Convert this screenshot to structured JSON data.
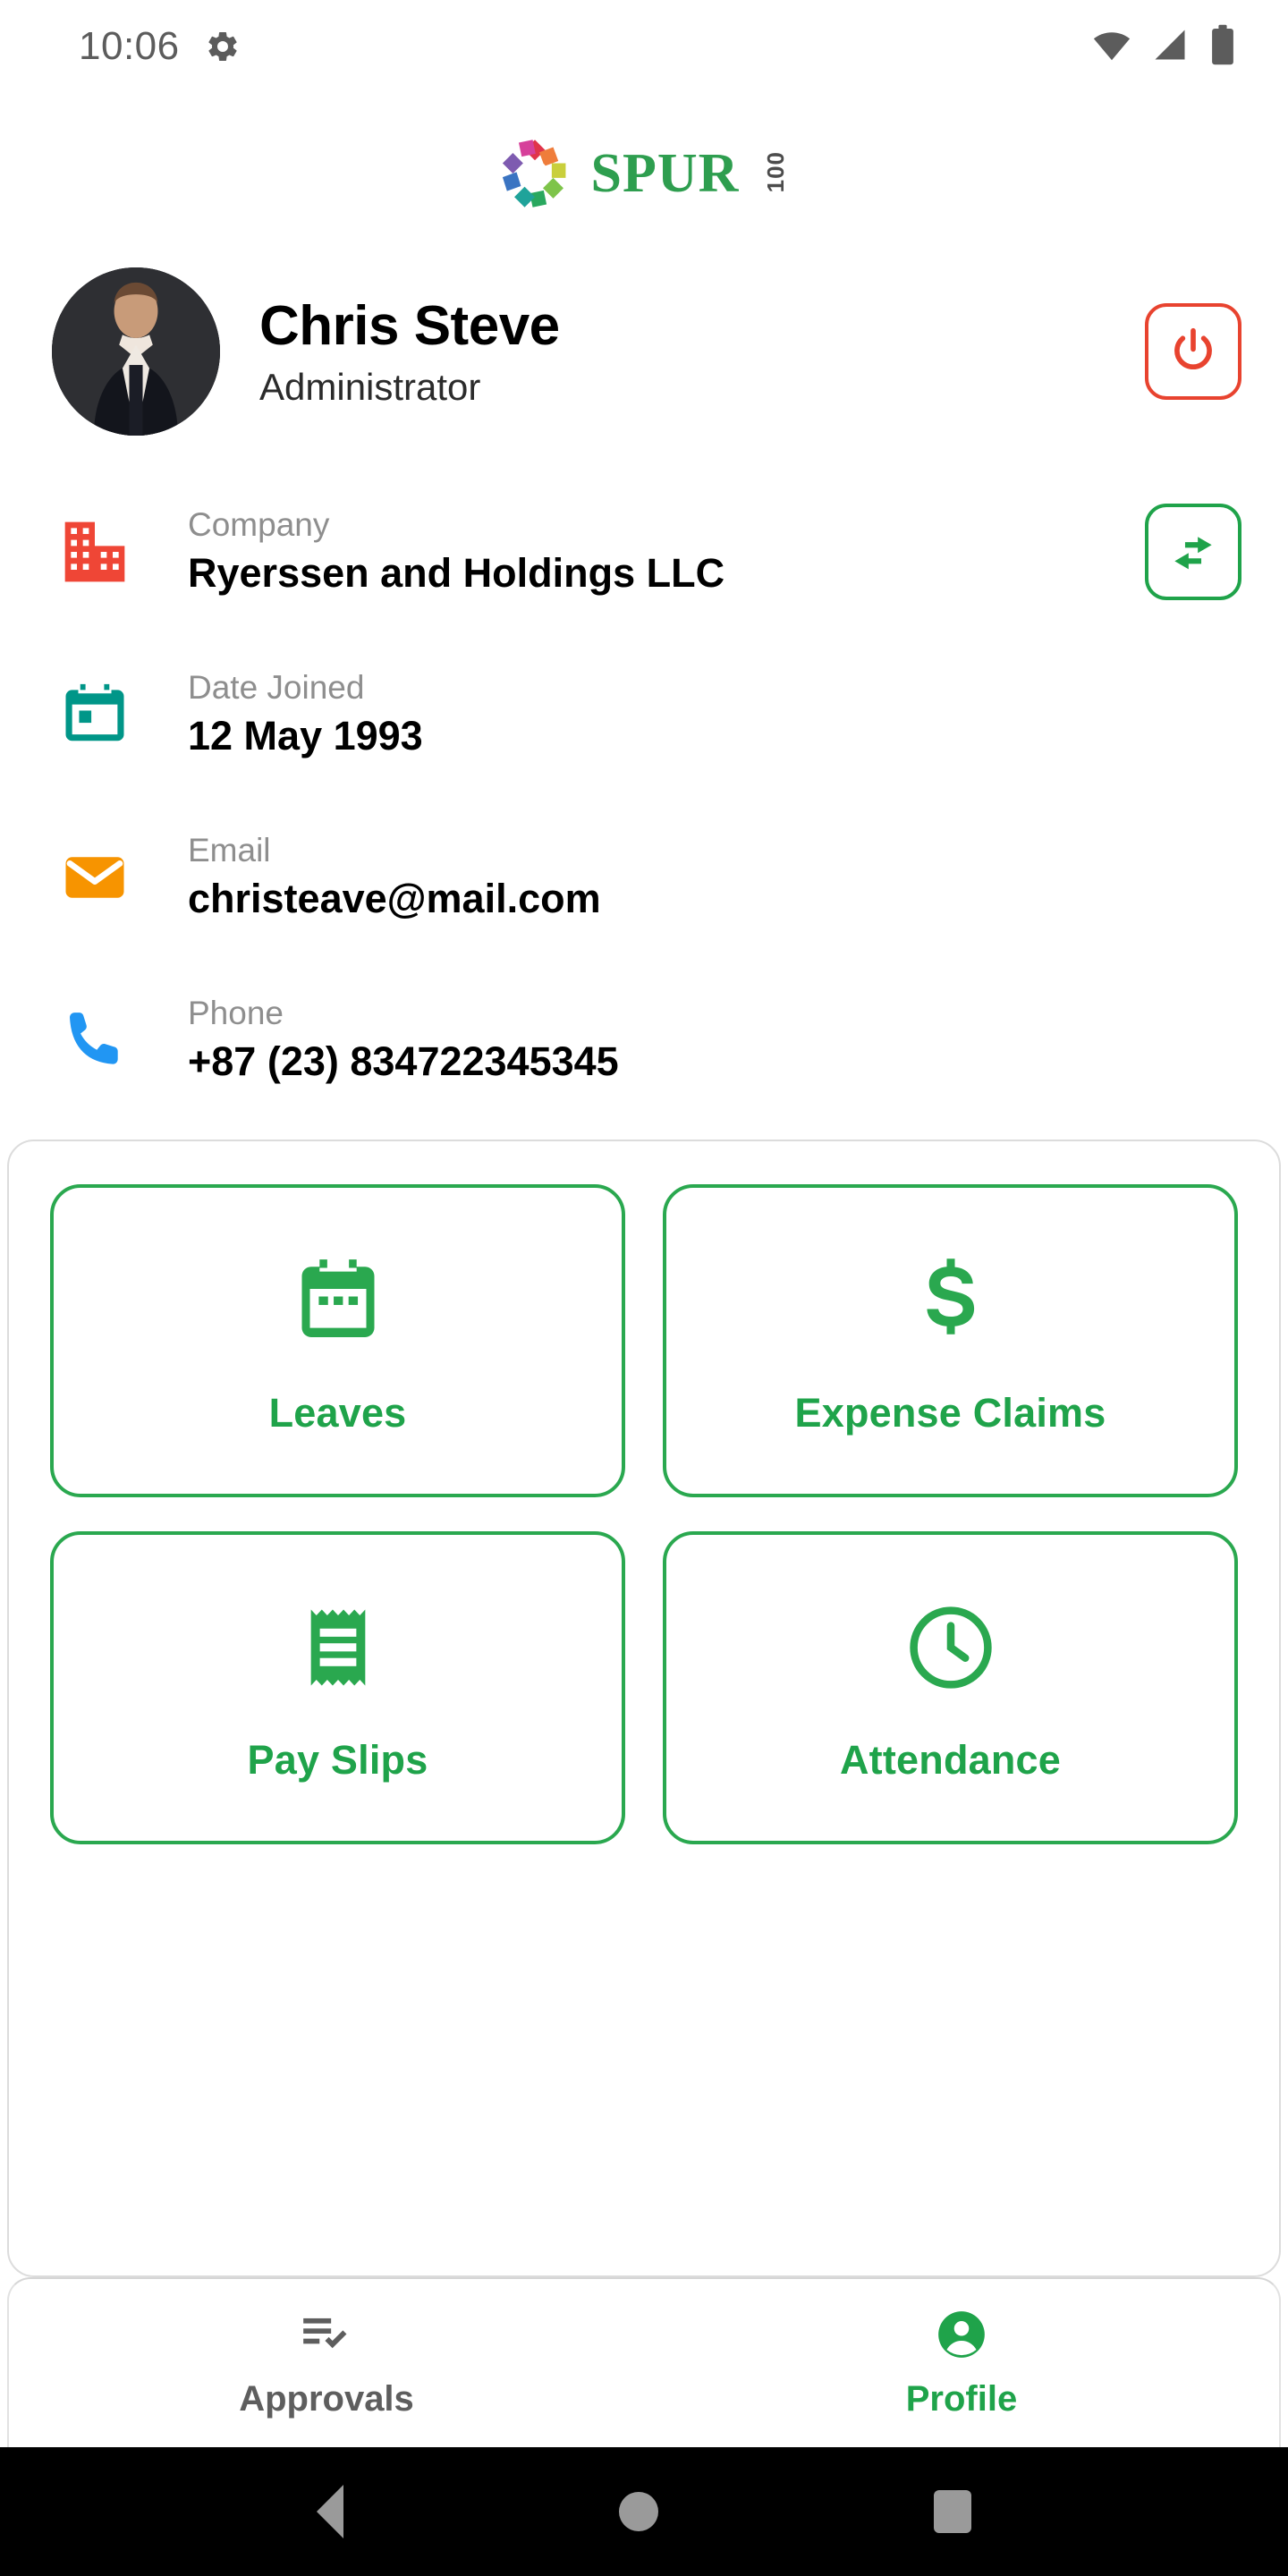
{
  "status_bar": {
    "time": "10:06",
    "gear_icon": "gear-icon",
    "wifi_icon": "wifi-icon",
    "signal_icon": "cellular-signal-icon",
    "battery_icon": "battery-icon"
  },
  "brand": {
    "mark_icon": "spur-pinwheel-logo-icon",
    "name": "SPUR",
    "superscript": "100",
    "green": "#2e9e4f"
  },
  "profile": {
    "avatar_icon": "user-avatar-photo",
    "name": "Chris Steve",
    "role": "Administrator",
    "logout": {
      "icon": "power-icon",
      "color": "#e8432f"
    },
    "switch": {
      "icon": "swap-horizontal-icon",
      "color": "#1fa34a"
    }
  },
  "info_rows": [
    {
      "icon": "office-building-icon",
      "icon_color": "#ef4636",
      "label": "Company",
      "value": "Ryerssen and Holdings LLC",
      "has_action": true
    },
    {
      "icon": "calendar-icon",
      "icon_color": "#009688",
      "label": "Date Joined",
      "value": "12 May 1993",
      "has_action": false
    },
    {
      "icon": "envelope-icon",
      "icon_color": "#f79400",
      "label": "Email",
      "value": "christeave@mail.com",
      "has_action": false
    },
    {
      "icon": "phone-icon",
      "icon_color": "#2196f3",
      "label": "Phone",
      "value": "+87 (23) 834722345345",
      "has_action": false
    }
  ],
  "action_tiles": [
    {
      "icon": "calendar-leaves-icon",
      "label": "Leaves"
    },
    {
      "icon": "dollar-sign-icon",
      "label": "Expense Claims"
    },
    {
      "icon": "receipt-icon",
      "label": "Pay Slips"
    },
    {
      "icon": "clock-icon",
      "label": "Attendance"
    }
  ],
  "bottom_nav": {
    "tabs": [
      {
        "icon": "playlist-check-icon",
        "label": "Approvals",
        "active": false
      },
      {
        "icon": "account-circle-icon",
        "label": "Profile",
        "active": true
      }
    ],
    "active_color": "#1fa34a",
    "inactive_color": "#5e5e5e"
  },
  "system_nav": {
    "back": "back-triangle-icon",
    "home": "home-circle-icon",
    "recents": "recents-square-icon"
  }
}
